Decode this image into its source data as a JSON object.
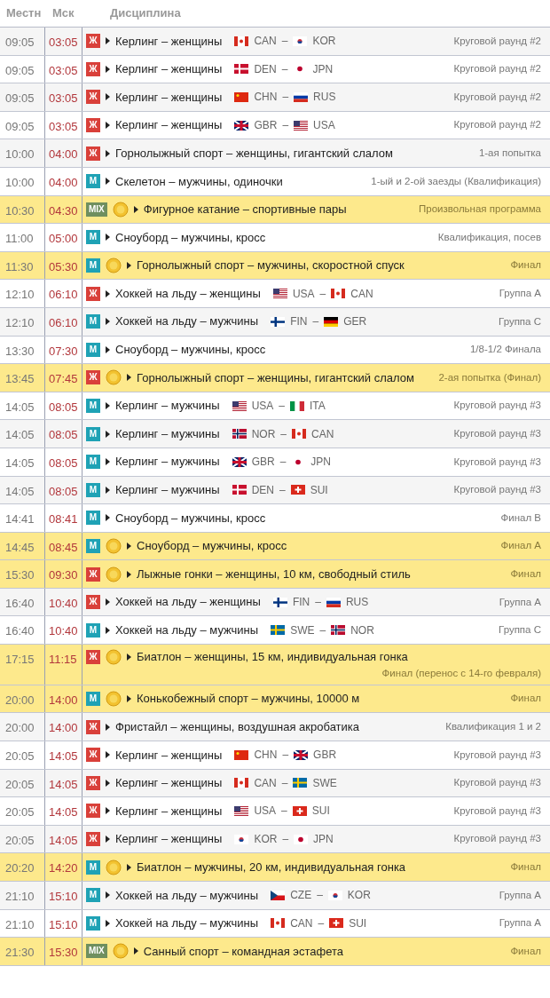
{
  "columns": [
    "Местн",
    "Мск",
    "Дисциплина"
  ],
  "rows": [
    {
      "local": "09:05",
      "msk": "03:05",
      "gender": {
        "kind": "w",
        "label": "Ж"
      },
      "medal": false,
      "event": "Керлинг – женщины",
      "teams": [
        {
          "code": "CAN",
          "kind": "ca"
        },
        {
          "code": "KOR",
          "kind": "kr"
        }
      ],
      "separator": "–",
      "stage": "Круговой раунд #2"
    },
    {
      "local": "09:05",
      "msk": "03:05",
      "gender": {
        "kind": "w",
        "label": "Ж"
      },
      "medal": false,
      "event": "Керлинг – женщины",
      "teams": [
        {
          "code": "DEN",
          "kind": "dk"
        },
        {
          "code": "JPN",
          "kind": "jp"
        }
      ],
      "separator": "–",
      "stage": "Круговой раунд #2"
    },
    {
      "local": "09:05",
      "msk": "03:05",
      "gender": {
        "kind": "w",
        "label": "Ж"
      },
      "medal": false,
      "event": "Керлинг – женщины",
      "teams": [
        {
          "code": "CHN",
          "kind": "cn"
        },
        {
          "code": "RUS",
          "kind": "ru"
        }
      ],
      "separator": "–",
      "stage": "Круговой раунд #2"
    },
    {
      "local": "09:05",
      "msk": "03:05",
      "gender": {
        "kind": "w",
        "label": "Ж"
      },
      "medal": false,
      "event": "Керлинг – женщины",
      "teams": [
        {
          "code": "GBR",
          "kind": "gb"
        },
        {
          "code": "USA",
          "kind": "us"
        }
      ],
      "separator": "–",
      "stage": "Круговой раунд #2"
    },
    {
      "local": "10:00",
      "msk": "04:00",
      "gender": {
        "kind": "w",
        "label": "Ж"
      },
      "medal": false,
      "event": "Горнолыжный спорт – женщины, гигантский слалом",
      "stage": "1-ая попытка"
    },
    {
      "local": "10:00",
      "msk": "04:00",
      "gender": {
        "kind": "m",
        "label": "М"
      },
      "medal": false,
      "event": "Скелетон – мужчины, одиночки",
      "stage": "1-ый и 2-ой заезды (Квалификация)"
    },
    {
      "local": "10:30",
      "msk": "04:30",
      "gender": {
        "kind": "mix",
        "label": "MIX"
      },
      "medal": true,
      "event": "Фигурное катание – спортивные пары",
      "stage": "Произвольная программа"
    },
    {
      "local": "11:00",
      "msk": "05:00",
      "gender": {
        "kind": "m",
        "label": "М"
      },
      "medal": false,
      "event": "Сноуборд – мужчины, кросс",
      "stage": "Квалификация, посев"
    },
    {
      "local": "11:30",
      "msk": "05:30",
      "gender": {
        "kind": "m",
        "label": "М"
      },
      "medal": true,
      "event": "Горнолыжный спорт – мужчины, скоростной спуск",
      "stage": "Финал"
    },
    {
      "local": "12:10",
      "msk": "06:10",
      "gender": {
        "kind": "w",
        "label": "Ж"
      },
      "medal": false,
      "event": "Хоккей на льду – женщины",
      "teams": [
        {
          "code": "USA",
          "kind": "us"
        },
        {
          "code": "CAN",
          "kind": "ca"
        }
      ],
      "separator": "–",
      "stage": "Группа A"
    },
    {
      "local": "12:10",
      "msk": "06:10",
      "gender": {
        "kind": "m",
        "label": "М"
      },
      "medal": false,
      "event": "Хоккей на льду – мужчины",
      "teams": [
        {
          "code": "FIN",
          "kind": "fi"
        },
        {
          "code": "GER",
          "kind": "de"
        }
      ],
      "separator": "–",
      "stage": "Группа C"
    },
    {
      "local": "13:30",
      "msk": "07:30",
      "gender": {
        "kind": "m",
        "label": "М"
      },
      "medal": false,
      "event": "Сноуборд – мужчины, кросс",
      "stage": "1/8-1/2 Финала"
    },
    {
      "local": "13:45",
      "msk": "07:45",
      "gender": {
        "kind": "w",
        "label": "Ж"
      },
      "medal": true,
      "event": "Горнолыжный спорт – женщины, гигантский слалом",
      "stage": "2-ая попытка (Финал)"
    },
    {
      "local": "14:05",
      "msk": "08:05",
      "gender": {
        "kind": "m",
        "label": "М"
      },
      "medal": false,
      "event": "Керлинг – мужчины",
      "teams": [
        {
          "code": "USA",
          "kind": "us"
        },
        {
          "code": "ITA",
          "kind": "it"
        }
      ],
      "separator": "–",
      "stage": "Круговой раунд #3"
    },
    {
      "local": "14:05",
      "msk": "08:05",
      "gender": {
        "kind": "m",
        "label": "М"
      },
      "medal": false,
      "event": "Керлинг – мужчины",
      "teams": [
        {
          "code": "NOR",
          "kind": "no"
        },
        {
          "code": "CAN",
          "kind": "ca"
        }
      ],
      "separator": "–",
      "stage": "Круговой раунд #3"
    },
    {
      "local": "14:05",
      "msk": "08:05",
      "gender": {
        "kind": "m",
        "label": "М"
      },
      "medal": false,
      "event": "Керлинг – мужчины",
      "teams": [
        {
          "code": "GBR",
          "kind": "gb"
        },
        {
          "code": "JPN",
          "kind": "jp"
        }
      ],
      "separator": "–",
      "stage": "Круговой раунд #3"
    },
    {
      "local": "14:05",
      "msk": "08:05",
      "gender": {
        "kind": "m",
        "label": "М"
      },
      "medal": false,
      "event": "Керлинг – мужчины",
      "teams": [
        {
          "code": "DEN",
          "kind": "dk"
        },
        {
          "code": "SUI",
          "kind": "ch"
        }
      ],
      "separator": "–",
      "stage": "Круговой раунд #3"
    },
    {
      "local": "14:41",
      "msk": "08:41",
      "gender": {
        "kind": "m",
        "label": "М"
      },
      "medal": false,
      "event": "Сноуборд – мужчины, кросс",
      "stage": "Финал B"
    },
    {
      "local": "14:45",
      "msk": "08:45",
      "gender": {
        "kind": "m",
        "label": "М"
      },
      "medal": true,
      "event": "Сноуборд – мужчины, кросс",
      "stage": "Финал A"
    },
    {
      "local": "15:30",
      "msk": "09:30",
      "gender": {
        "kind": "w",
        "label": "Ж"
      },
      "medal": true,
      "event": "Лыжные гонки – женщины, 10 км, свободный стиль",
      "stage": "Финал"
    },
    {
      "local": "16:40",
      "msk": "10:40",
      "gender": {
        "kind": "w",
        "label": "Ж"
      },
      "medal": false,
      "event": "Хоккей на льду – женщины",
      "teams": [
        {
          "code": "FIN",
          "kind": "fi"
        },
        {
          "code": "RUS",
          "kind": "ru"
        }
      ],
      "separator": "–",
      "stage": "Группа A"
    },
    {
      "local": "16:40",
      "msk": "10:40",
      "gender": {
        "kind": "m",
        "label": "М"
      },
      "medal": false,
      "event": "Хоккей на льду – мужчины",
      "teams": [
        {
          "code": "SWE",
          "kind": "se"
        },
        {
          "code": "NOR",
          "kind": "no"
        }
      ],
      "separator": "–",
      "stage": "Группа C"
    },
    {
      "local": "17:15",
      "msk": "11:15",
      "gender": {
        "kind": "w",
        "label": "Ж"
      },
      "medal": true,
      "event": "Биатлон – женщины, 15 км, индивидуальная гонка",
      "stage": "Финал (перенос с 14-го февраля)"
    },
    {
      "local": "20:00",
      "msk": "14:00",
      "gender": {
        "kind": "m",
        "label": "М"
      },
      "medal": true,
      "event": "Конькобежный спорт – мужчины, 10000 м",
      "stage": "Финал"
    },
    {
      "local": "20:00",
      "msk": "14:00",
      "gender": {
        "kind": "w",
        "label": "Ж"
      },
      "medal": false,
      "event": "Фристайл – женщины, воздушная акробатика",
      "stage": "Квалификация 1 и 2"
    },
    {
      "local": "20:05",
      "msk": "14:05",
      "gender": {
        "kind": "w",
        "label": "Ж"
      },
      "medal": false,
      "event": "Керлинг – женщины",
      "teams": [
        {
          "code": "CHN",
          "kind": "cn"
        },
        {
          "code": "GBR",
          "kind": "gb"
        }
      ],
      "separator": "–",
      "stage": "Круговой раунд #3"
    },
    {
      "local": "20:05",
      "msk": "14:05",
      "gender": {
        "kind": "w",
        "label": "Ж"
      },
      "medal": false,
      "event": "Керлинг – женщины",
      "teams": [
        {
          "code": "CAN",
          "kind": "ca"
        },
        {
          "code": "SWE",
          "kind": "se"
        }
      ],
      "separator": "–",
      "stage": "Круговой раунд #3"
    },
    {
      "local": "20:05",
      "msk": "14:05",
      "gender": {
        "kind": "w",
        "label": "Ж"
      },
      "medal": false,
      "event": "Керлинг – женщины",
      "teams": [
        {
          "code": "USA",
          "kind": "us"
        },
        {
          "code": "SUI",
          "kind": "ch"
        }
      ],
      "separator": "–",
      "stage": "Круговой раунд #3"
    },
    {
      "local": "20:05",
      "msk": "14:05",
      "gender": {
        "kind": "w",
        "label": "Ж"
      },
      "medal": false,
      "event": "Керлинг – женщины",
      "teams": [
        {
          "code": "KOR",
          "kind": "kr"
        },
        {
          "code": "JPN",
          "kind": "jp"
        }
      ],
      "separator": "–",
      "stage": "Круговой раунд #3"
    },
    {
      "local": "20:20",
      "msk": "14:20",
      "gender": {
        "kind": "m",
        "label": "М"
      },
      "medal": true,
      "event": "Биатлон – мужчины, 20 км, индивидуальная гонка",
      "stage": "Финал"
    },
    {
      "local": "21:10",
      "msk": "15:10",
      "gender": {
        "kind": "m",
        "label": "М"
      },
      "medal": false,
      "event": "Хоккей на льду – мужчины",
      "teams": [
        {
          "code": "CZE",
          "kind": "cz"
        },
        {
          "code": "KOR",
          "kind": "kr"
        }
      ],
      "separator": "–",
      "stage": "Группа A"
    },
    {
      "local": "21:10",
      "msk": "15:10",
      "gender": {
        "kind": "m",
        "label": "М"
      },
      "medal": false,
      "event": "Хоккей на льду – мужчины",
      "teams": [
        {
          "code": "CAN",
          "kind": "ca"
        },
        {
          "code": "SUI",
          "kind": "ch"
        }
      ],
      "separator": "–",
      "stage": "Группа A"
    },
    {
      "local": "21:30",
      "msk": "15:30",
      "gender": {
        "kind": "mix",
        "label": "MIX"
      },
      "medal": true,
      "event": "Санный спорт – командная эстафета",
      "stage": "Финал"
    }
  ]
}
